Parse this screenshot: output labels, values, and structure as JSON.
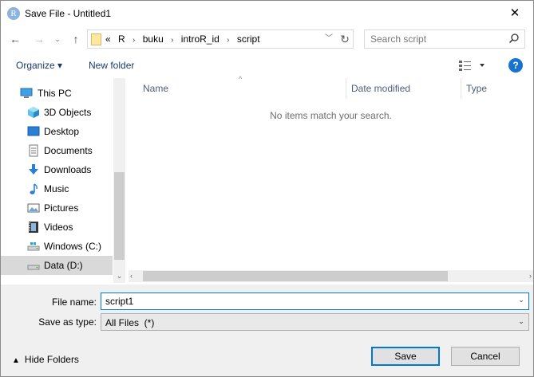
{
  "window": {
    "title": "Save File - Untitled1",
    "app_icon_letter": "R",
    "close_glyph": "✕"
  },
  "nav": {
    "back_glyph": "←",
    "forward_glyph": "→",
    "recent_glyph": "⌄",
    "up_glyph": "↑",
    "breadcrumb": [
      "«",
      "R",
      "›",
      "buku",
      "›",
      "introR_id",
      "›",
      "script"
    ],
    "dropdown_glyph": "﹀",
    "refresh_glyph": "↻",
    "search_placeholder": "Search script"
  },
  "toolbar": {
    "organize_label": "Organize ▾",
    "new_folder_label": "New folder",
    "help_label": "?"
  },
  "sidebar": {
    "items": [
      {
        "label": "This PC",
        "icon": "this-pc-icon"
      },
      {
        "label": "3D Objects",
        "icon": "3d-objects-icon"
      },
      {
        "label": "Desktop",
        "icon": "desktop-icon"
      },
      {
        "label": "Documents",
        "icon": "documents-icon"
      },
      {
        "label": "Downloads",
        "icon": "downloads-icon"
      },
      {
        "label": "Music",
        "icon": "music-icon"
      },
      {
        "label": "Pictures",
        "icon": "pictures-icon"
      },
      {
        "label": "Videos",
        "icon": "videos-icon"
      },
      {
        "label": "Windows (C:)",
        "icon": "drive-c-icon"
      },
      {
        "label": "Data (D:)",
        "icon": "drive-d-icon",
        "selected": true
      }
    ],
    "scroll_down_glyph": "⌄"
  },
  "filelist": {
    "columns": [
      "Name",
      "Date modified",
      "Type"
    ],
    "sort_glyph": "^",
    "empty_message": "No items match your search.",
    "scroll_left_glyph": "‹",
    "scroll_right_glyph": "›"
  },
  "form": {
    "file_name_label": "File name:",
    "file_name_value": "script1",
    "save_as_type_label": "Save as type:",
    "save_as_type_value": "All Files  (*)",
    "caret_glyph": "⌄"
  },
  "footer": {
    "hide_folders_label": "Hide Folders",
    "hide_folders_glyph": "▲",
    "save_label": "Save",
    "cancel_label": "Cancel"
  },
  "colors": {
    "accent": "#0078d7",
    "link_text": "#1b3a6a",
    "header_text": "#4c607a",
    "bottom_bg": "#f0f0f0"
  }
}
